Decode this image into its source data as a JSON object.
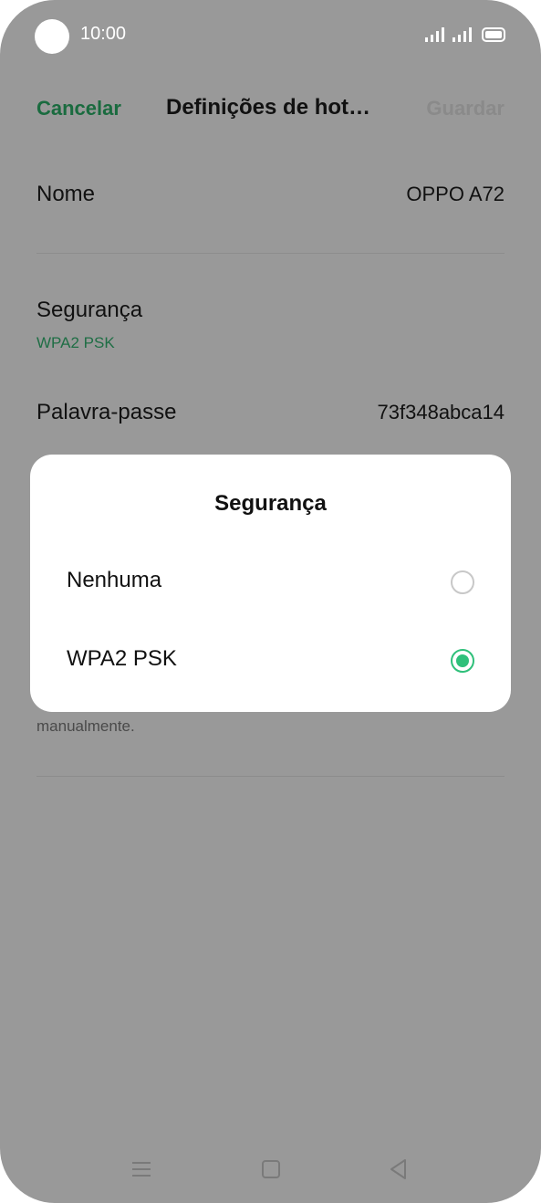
{
  "status_bar": {
    "time": "10:00"
  },
  "header": {
    "cancel_label": "Cancelar",
    "title": "Definições de hot…",
    "save_label": "Guardar"
  },
  "settings": {
    "name": {
      "label": "Nome",
      "value": "OPPO A72"
    },
    "security": {
      "label": "Segurança",
      "value": "WPA2 PSK"
    },
    "password": {
      "label": "Palavra-passe",
      "value": "73f348abca14"
    },
    "note_fragment": "manualmente."
  },
  "dialog": {
    "title": "Segurança",
    "options": [
      {
        "label": "Nenhuma",
        "selected": false
      },
      {
        "label": "WPA2 PSK",
        "selected": true
      }
    ]
  },
  "colors": {
    "accent_green": "#2fc07a",
    "link_green": "#1a6b3f",
    "overlay_gray": "#999999"
  },
  "icons": {
    "nav": [
      "menu-icon",
      "home-icon",
      "back-icon"
    ],
    "status": [
      "signal-icon",
      "signal-icon",
      "battery-icon"
    ]
  }
}
